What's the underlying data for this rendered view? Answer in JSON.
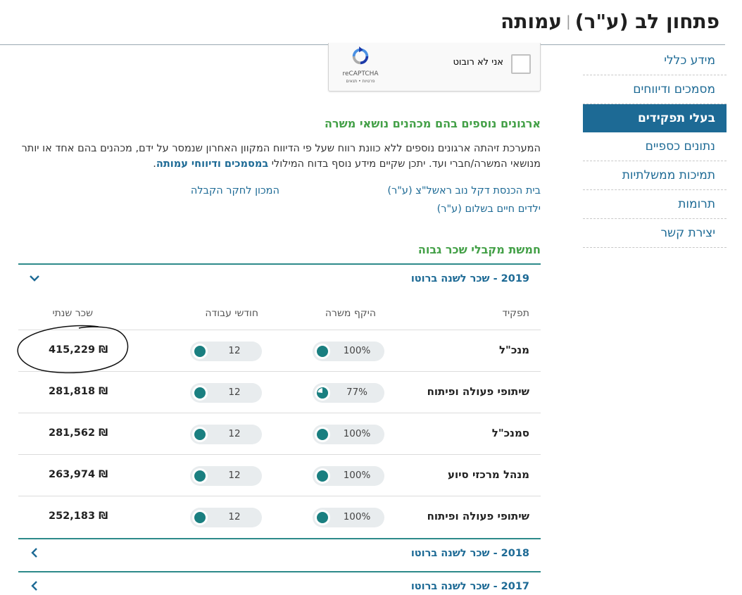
{
  "header": {
    "title_main": "פתחון לב (ע\"ר)",
    "title_sub": "עמותה"
  },
  "sidebar": {
    "items": [
      {
        "label": "מידע כללי",
        "active": false
      },
      {
        "label": "מסמכים ודיווחים",
        "active": false
      },
      {
        "label": "בעלי תפקידים",
        "active": true
      },
      {
        "label": "נתונים כספיים",
        "active": false
      },
      {
        "label": "תמיכות ממשלתיות",
        "active": false
      },
      {
        "label": "תרומות",
        "active": false
      },
      {
        "label": "יצירת קשר",
        "active": false
      }
    ]
  },
  "captcha": {
    "label": "אני לא רובוט",
    "brand": "reCAPTCHA",
    "terms": "פרטיות • תנאים"
  },
  "orgs": {
    "title": "ארגונים נוספים בהם מכהנים נושאי משרה",
    "desc_text": "המערכת זיהתה ארגונים נוספים ללא כוונת רווח שעל פי הדיווח המקוון האחרון שנמסר על ידם, מכהנים בהם אחד או יותר מנושאי המשרה/חברי ועד. יתכן שקיים מידע נוסף בדוח המילולי",
    "desc_link": "במסמכים ודיווחי עמותה",
    "desc_end": ".",
    "links": [
      "בית הכנסת דקל נוב ראשל\"צ (ע\"ר)",
      "המכון לחקר הקבלה",
      "ילדים חיים בשלום (ע\"ר)"
    ]
  },
  "earners": {
    "title": "חמשת מקבלי שכר גבוה",
    "years": [
      {
        "label": "2019 - שכר לשנה ברוטו",
        "expanded": true
      },
      {
        "label": "2018 - שכר לשנה ברוטו",
        "expanded": false
      },
      {
        "label": "2017 - שכר לשנה ברוטו",
        "expanded": false
      }
    ],
    "columns": {
      "role": "תפקיד",
      "scope": "היקף משרה",
      "months": "חודשי עבודה",
      "salary": "שכר שנתי"
    },
    "rows": [
      {
        "role": "מנכ\"ל",
        "scope": "100%",
        "scope_fraction": 1.0,
        "months": "12",
        "salary": "415,229 ₪"
      },
      {
        "role": "שיתופי פעולה ופיתוח",
        "scope": "77%",
        "scope_fraction": 0.77,
        "months": "12",
        "salary": "281,818 ₪"
      },
      {
        "role": "סמנכ\"ל",
        "scope": "100%",
        "scope_fraction": 1.0,
        "months": "12",
        "salary": "281,562 ₪"
      },
      {
        "role": "מנהל מרכזי סיוע",
        "scope": "100%",
        "scope_fraction": 1.0,
        "months": "12",
        "salary": "263,974 ₪"
      },
      {
        "role": "שיתופי פעולה ופיתוח",
        "scope": "100%",
        "scope_fraction": 1.0,
        "months": "12",
        "salary": "252,183 ₪"
      }
    ]
  },
  "colors": {
    "accent_blue": "#1d6a95",
    "accent_green": "#43a047",
    "teal": "#2d8a8a",
    "circle_fill": "#1a7f80"
  }
}
